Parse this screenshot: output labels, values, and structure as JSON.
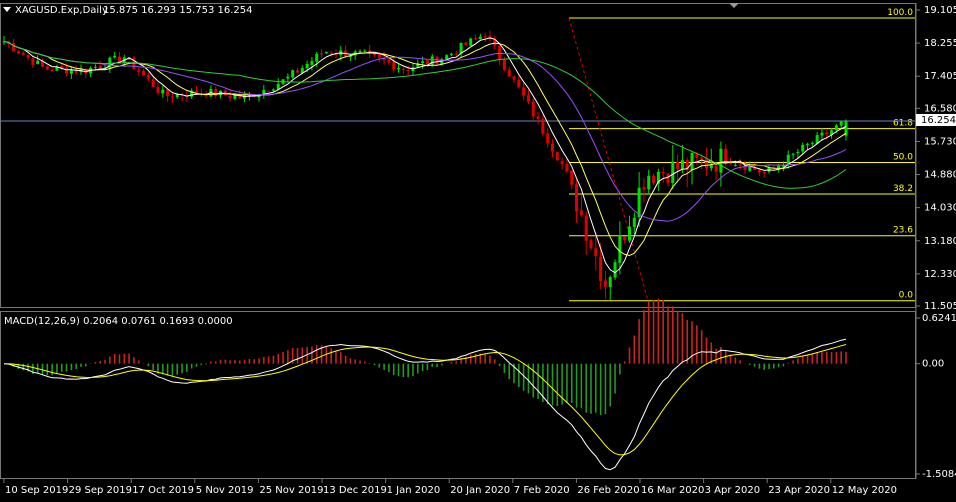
{
  "colors": {
    "background": "#000000",
    "bull": "#00e000",
    "bear": "#e00000",
    "ma_fast": "#ffffff",
    "ma_mid": "#ffff66",
    "ma_slow": "#9a4dff",
    "ma_long": "#33cc33",
    "fib": "#ffff00",
    "price_line": "#6f7fbf",
    "macd_line": "#ffffff",
    "signal_line": "#ffff00",
    "hist_pos": "#cc2222",
    "hist_neg": "#229922"
  },
  "header": {
    "symbol": "XAGUSD.Exp,Daily",
    "ohlc": "15.875 16.293 15.753 16.254"
  },
  "price_axis": {
    "ticks": [
      "19.105",
      "18.255",
      "17.405",
      "16.580",
      "15.730",
      "14.880",
      "14.030",
      "13.180",
      "12.330",
      "11.505"
    ],
    "current": "16.254"
  },
  "fib_levels": [
    {
      "label": "100.0",
      "value": 18.9
    },
    {
      "label": "61.8",
      "value": 16.06
    },
    {
      "label": "50.0",
      "value": 15.19
    },
    {
      "label": "38.2",
      "value": 14.38
    },
    {
      "label": "23.6",
      "value": 13.31
    },
    {
      "label": "0.0",
      "value": 11.64
    }
  ],
  "macd": {
    "label": "MACD(12,26,9) 0.2064 0.0761 0.1693 0.0000",
    "ticks": [
      "0.6241",
      "0.00",
      "-1.5084"
    ]
  },
  "time_axis": {
    "ticks": [
      "10 Sep 2019",
      "29 Sep 2019",
      "17 Oct 2019",
      "5 Nov 2019",
      "25 Nov 2019",
      "13 Dec 2019",
      "1 Jan 2020",
      "20 Jan 2020",
      "7 Feb 2020",
      "26 Feb 2020",
      "16 Mar 2020",
      "3 Apr 2020",
      "23 Apr 2020",
      "12 May 2020"
    ]
  },
  "chart_data": {
    "type": "candlestick",
    "title": "XAGUSD.Exp,Daily",
    "ylim": [
      11.505,
      19.105
    ],
    "x": [
      "10 Sep 2019",
      "29 Sep 2019",
      "17 Oct 2019",
      "5 Nov 2019",
      "25 Nov 2019",
      "13 Dec 2019",
      "1 Jan 2020",
      "20 Jan 2020",
      "7 Feb 2020",
      "26 Feb 2020",
      "16 Mar 2020",
      "3 Apr 2020",
      "23 Apr 2020",
      "12 May 2020"
    ],
    "close_path": [
      18.3,
      17.6,
      17.55,
      17.9,
      16.9,
      17.0,
      16.85,
      17.3,
      18.05,
      17.95,
      17.6,
      17.9,
      18.5,
      16.8,
      15.0,
      12.1,
      14.9,
      15.1,
      15.3,
      14.9,
      15.6,
      16.25
    ],
    "last": {
      "open": 15.875,
      "high": 16.293,
      "low": 15.753,
      "close": 16.254
    },
    "macd": {
      "name": "MACD(12,26,9)",
      "values": [
        0.2064,
        0.0761,
        0.1693,
        0.0
      ],
      "ylim": [
        -1.5084,
        0.6241
      ]
    }
  }
}
